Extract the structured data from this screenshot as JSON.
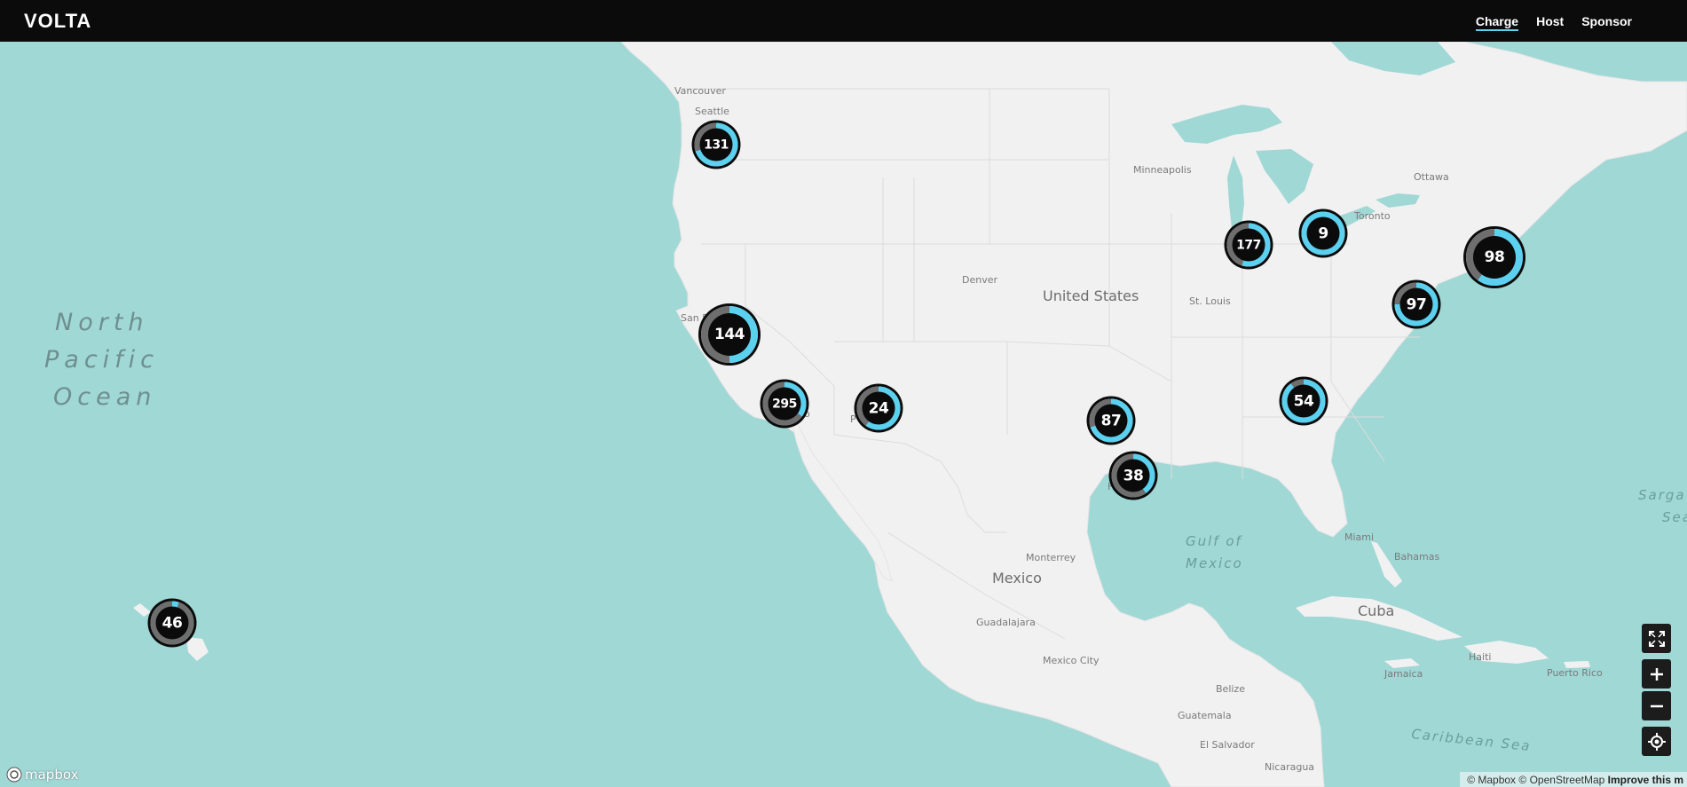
{
  "header": {
    "logo": "VOLTA",
    "nav": [
      {
        "label": "Charge",
        "active": true
      },
      {
        "label": "Host",
        "active": false
      },
      {
        "label": "Sponsor",
        "active": false
      }
    ]
  },
  "map": {
    "ocean_label_lines": [
      "North",
      "Pacific",
      "Ocean"
    ],
    "labels": {
      "vancouver": "Vancouver",
      "seattle": "Seattle",
      "minneapolis": "Minneapolis",
      "ottawa": "Ottawa",
      "toronto": "Toronto",
      "denver": "Denver",
      "united_states": "United States",
      "st_louis": "St. Louis",
      "san_fr": "San Fr",
      "ph": "P",
      "co": "o",
      "h": "H",
      "gulf_line1": "Gulf of",
      "gulf_line2": "Mexico",
      "miami": "Miami",
      "bahamas": "Bahamas",
      "monterrey": "Monterrey",
      "mexico": "Mexico",
      "guadalajara": "Guadalajara",
      "mexico_city": "Mexico City",
      "cuba": "Cuba",
      "haiti": "Haiti",
      "jamaica": "Jamaica",
      "puerto_rico": "Puerto Rico",
      "belize": "Belize",
      "guatemala": "Guatemala",
      "el_salvador": "El Salvador",
      "nicaragua": "Nicaragua",
      "caribbean_sea": "Caribbean Sea",
      "sargasso_line1": "Sarga",
      "sargasso_line2": "Sea"
    }
  },
  "clusters": [
    {
      "id": "seattle",
      "count": "131",
      "available_fraction": 0.7
    },
    {
      "id": "bay-area",
      "count": "144",
      "available_fraction": 0.5
    },
    {
      "id": "los-angeles",
      "count": "295",
      "available_fraction": 0.35
    },
    {
      "id": "phoenix",
      "count": "24",
      "available_fraction": 0.6
    },
    {
      "id": "hawaii",
      "count": "46",
      "available_fraction": 0.05
    },
    {
      "id": "chicago",
      "count": "177",
      "available_fraction": 0.55
    },
    {
      "id": "michigan",
      "count": "9",
      "available_fraction": 1.0
    },
    {
      "id": "northeast",
      "count": "98",
      "available_fraction": 0.6
    },
    {
      "id": "dc",
      "count": "97",
      "available_fraction": 0.75
    },
    {
      "id": "atlanta",
      "count": "54",
      "available_fraction": 0.9
    },
    {
      "id": "dallas",
      "count": "87",
      "available_fraction": 0.7
    },
    {
      "id": "houston",
      "count": "38",
      "available_fraction": 0.4
    }
  ],
  "colors": {
    "available": "#5bd0ef",
    "unavailable": "#6e6e6e",
    "ring_outline": "#0b0b0b",
    "water": "#a0d8d6",
    "land": "#f1f1f1"
  },
  "controls": [
    {
      "id": "fullscreen",
      "icon": "fullscreen-icon"
    },
    {
      "id": "zoom-in",
      "icon": "plus-icon"
    },
    {
      "id": "zoom-out",
      "icon": "minus-icon"
    },
    {
      "id": "geolocate",
      "icon": "crosshair-icon"
    }
  ],
  "attribution": {
    "mapbox_logo": "mapbox",
    "mapbox_link": "© Mapbox",
    "osm_link": "© OpenStreetMap",
    "improve": "Improve this m"
  }
}
